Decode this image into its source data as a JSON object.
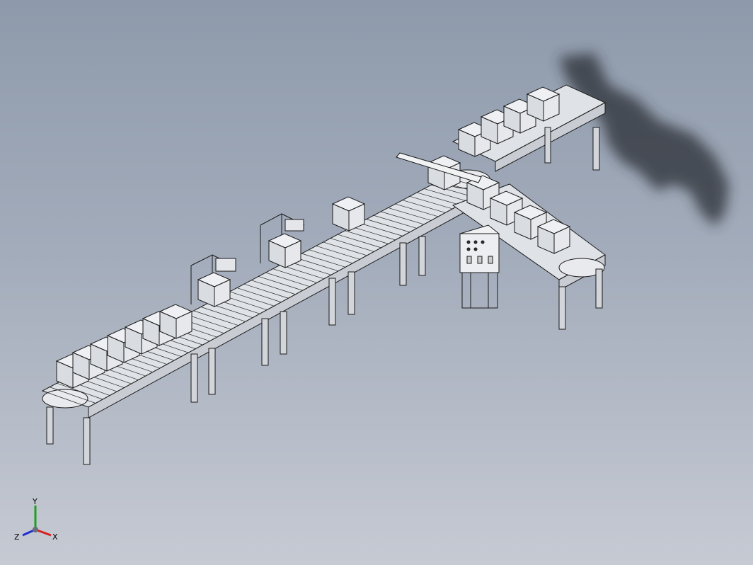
{
  "viewport": {
    "background_top": "#8e9aab",
    "background_bottom": "#c6cad3"
  },
  "model": {
    "line_color": "#1a1a1a",
    "part_fill": "#e4e6ea",
    "belt_fill": "#dfe2e6",
    "panel_fill": "#eceef1"
  },
  "triad": {
    "x_label": "X",
    "y_label": "Y",
    "z_label": "Z",
    "x_color": "#d62020",
    "y_color": "#1fa01f",
    "z_color": "#2030d0"
  }
}
